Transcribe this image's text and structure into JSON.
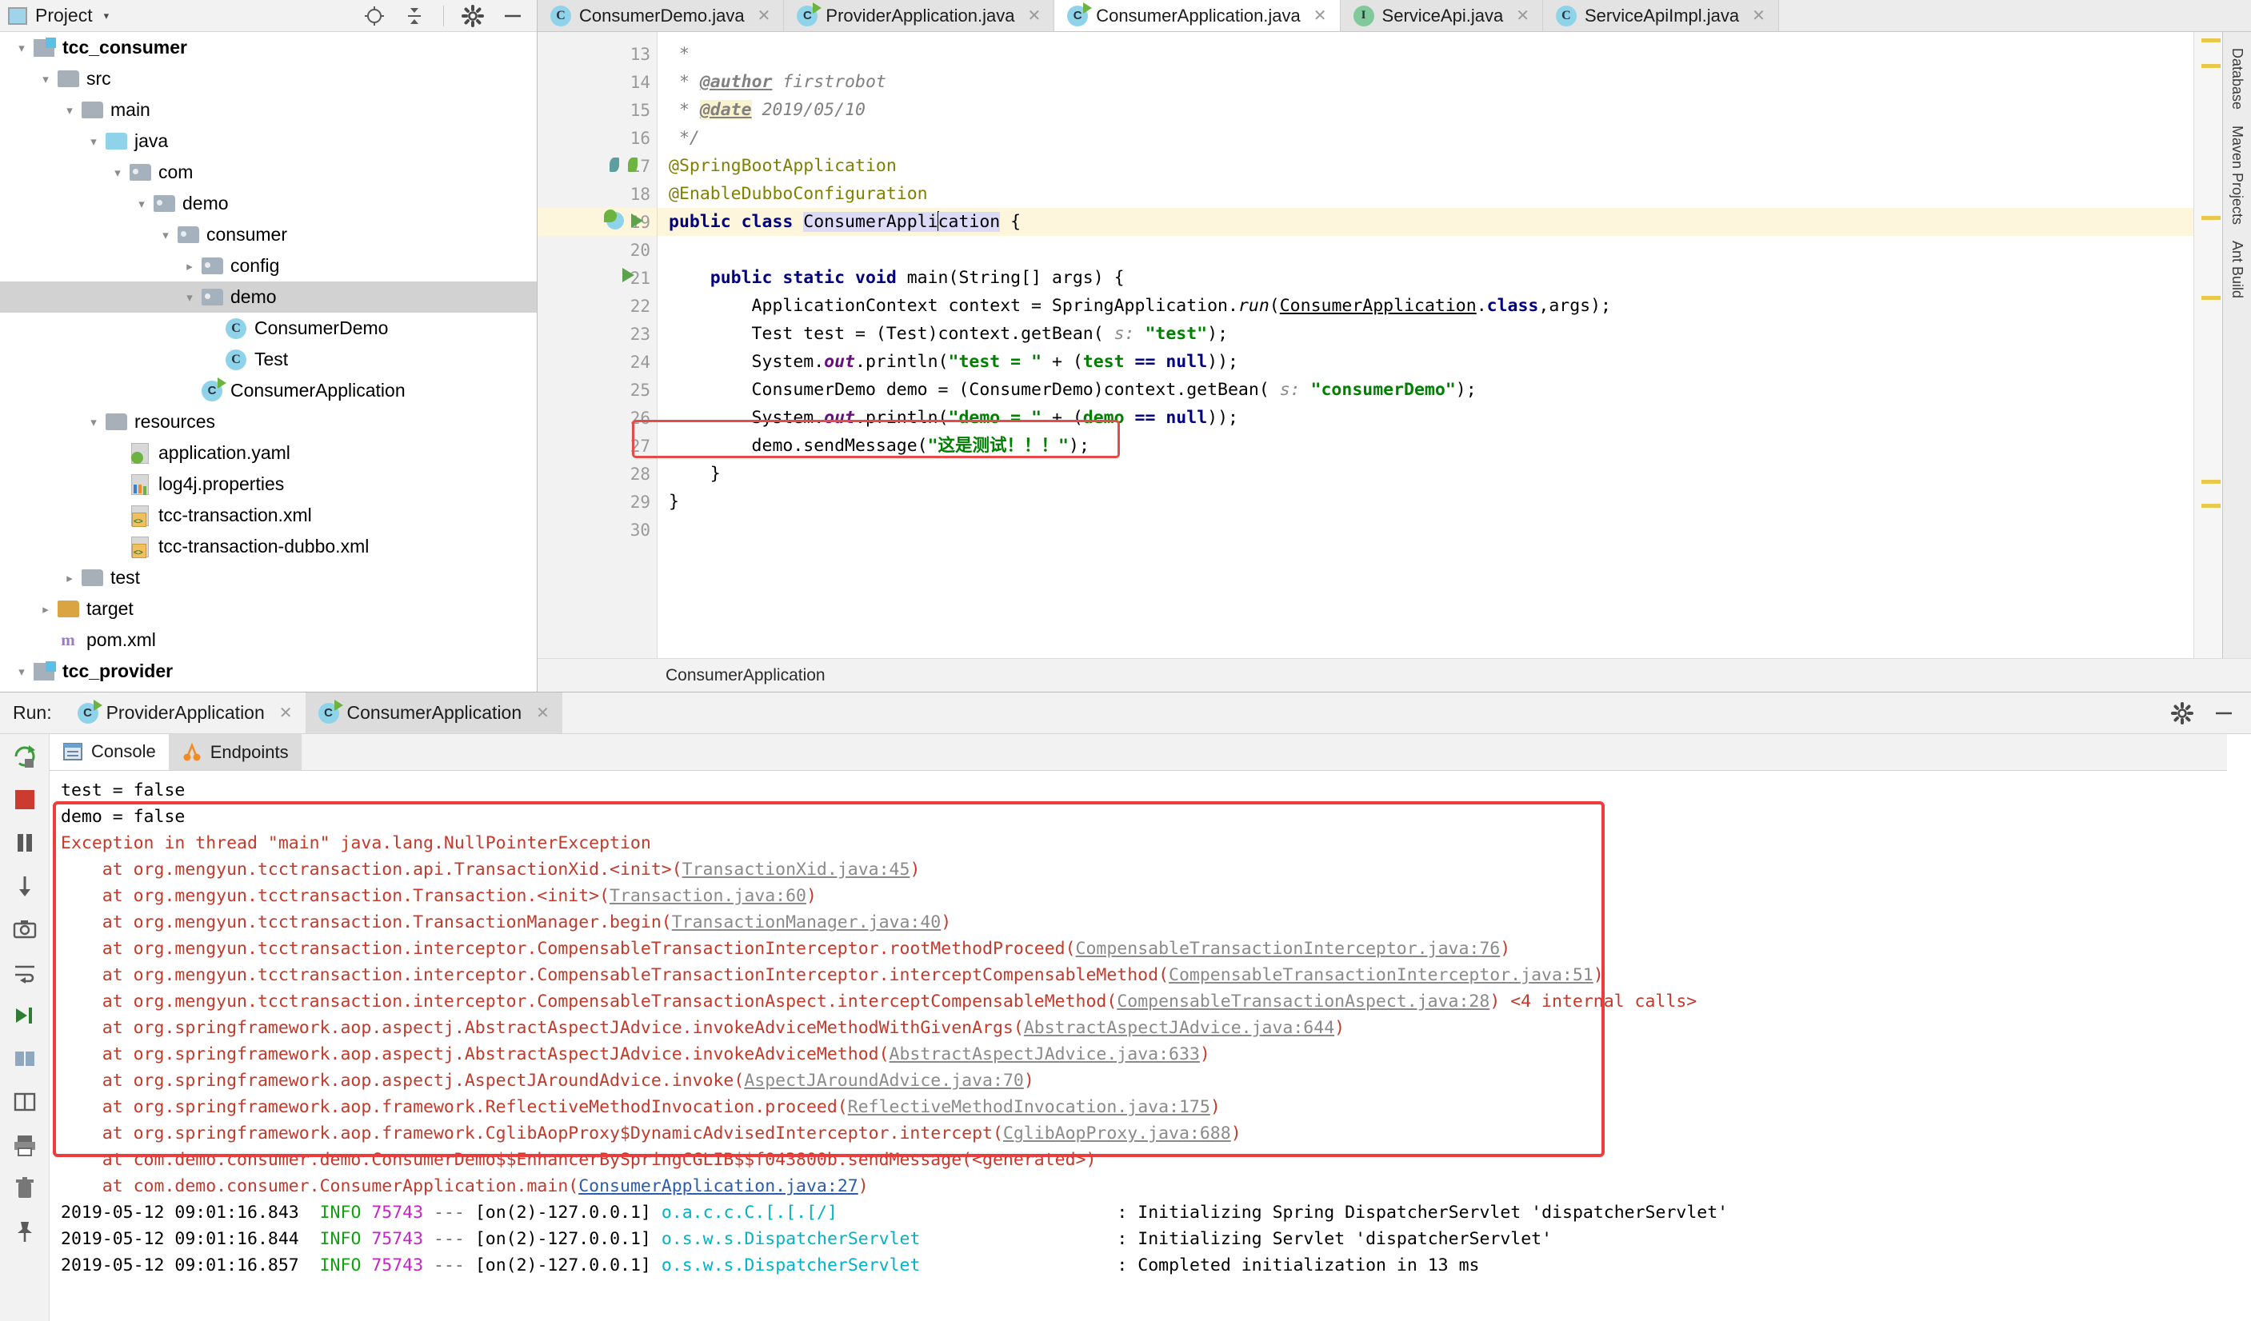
{
  "project_panel": {
    "title": "Project",
    "caret": "▾",
    "icons": [
      "locate-icon",
      "collapse-all-icon",
      "gear-icon",
      "minimize-icon"
    ],
    "tree": [
      {
        "label": "tcc_consumer",
        "indent": 0,
        "arrow": "▾",
        "icon": "module-icon",
        "bold": true,
        "selected": false
      },
      {
        "label": "src",
        "indent": 1,
        "arrow": "▾",
        "icon": "folder-icon",
        "bold": false,
        "selected": false
      },
      {
        "label": "main",
        "indent": 2,
        "arrow": "▾",
        "icon": "folder-icon",
        "bold": false,
        "selected": false
      },
      {
        "label": "java",
        "indent": 3,
        "arrow": "▾",
        "icon": "source-folder-icon",
        "bold": false,
        "selected": false
      },
      {
        "label": "com",
        "indent": 4,
        "arrow": "▾",
        "icon": "package-icon",
        "bold": false,
        "selected": false
      },
      {
        "label": "demo",
        "indent": 5,
        "arrow": "▾",
        "icon": "package-icon",
        "bold": false,
        "selected": false
      },
      {
        "label": "consumer",
        "indent": 6,
        "arrow": "▾",
        "icon": "package-icon",
        "bold": false,
        "selected": false
      },
      {
        "label": "config",
        "indent": 7,
        "arrow": "▸",
        "icon": "package-icon",
        "bold": false,
        "selected": false
      },
      {
        "label": "demo",
        "indent": 7,
        "arrow": "▾",
        "icon": "package-icon",
        "bold": false,
        "selected": true
      },
      {
        "label": "ConsumerDemo",
        "indent": 8,
        "arrow": "",
        "icon": "class-icon",
        "bold": false,
        "selected": false
      },
      {
        "label": "Test",
        "indent": 8,
        "arrow": "",
        "icon": "class-icon",
        "bold": false,
        "selected": false
      },
      {
        "label": "ConsumerApplication",
        "indent": 7,
        "arrow": "",
        "icon": "spring-class-icon",
        "bold": false,
        "selected": false
      },
      {
        "label": "resources",
        "indent": 3,
        "arrow": "▾",
        "icon": "resource-folder-icon",
        "bold": false,
        "selected": false
      },
      {
        "label": "application.yaml",
        "indent": 4,
        "arrow": "",
        "icon": "yaml-file-icon",
        "bold": false,
        "selected": false
      },
      {
        "label": "log4j.properties",
        "indent": 4,
        "arrow": "",
        "icon": "properties-file-icon",
        "bold": false,
        "selected": false
      },
      {
        "label": "tcc-transaction.xml",
        "indent": 4,
        "arrow": "",
        "icon": "xml-file-icon",
        "bold": false,
        "selected": false
      },
      {
        "label": "tcc-transaction-dubbo.xml",
        "indent": 4,
        "arrow": "",
        "icon": "xml-file-icon",
        "bold": false,
        "selected": false
      },
      {
        "label": "test",
        "indent": 2,
        "arrow": "▸",
        "icon": "folder-icon",
        "bold": false,
        "selected": false
      },
      {
        "label": "target",
        "indent": 1,
        "arrow": "▸",
        "icon": "target-folder-icon",
        "bold": false,
        "selected": false
      },
      {
        "label": "pom.xml",
        "indent": 1,
        "arrow": "",
        "icon": "maven-file-icon",
        "bold": false,
        "selected": false
      },
      {
        "label": "tcc_provider",
        "indent": 0,
        "arrow": "▾",
        "icon": "module-icon",
        "bold": true,
        "selected": false
      }
    ]
  },
  "editor": {
    "tabs": [
      {
        "label": "ConsumerDemo.java",
        "icon": "class-icon",
        "active": false,
        "closable": true
      },
      {
        "label": "ProviderApplication.java",
        "icon": "spring-class-icon",
        "active": false,
        "closable": true
      },
      {
        "label": "ConsumerApplication.java",
        "icon": "spring-class-icon",
        "active": true,
        "closable": true
      },
      {
        "label": "ServiceApi.java",
        "icon": "interface-icon",
        "active": false,
        "closable": true
      },
      {
        "label": "ServiceApiImpl.java",
        "icon": "class-icon",
        "active": false,
        "closable": true
      }
    ],
    "breadcrumb": "ConsumerApplication",
    "first_line_number": 13,
    "lines": [
      {
        "n": 13,
        "text": " *"
      },
      {
        "n": 14,
        "text": " * @author firstrobot"
      },
      {
        "n": 15,
        "text": " * @date 2019/05/10"
      },
      {
        "n": 16,
        "text": " */"
      },
      {
        "n": 17,
        "text": "@SpringBootApplication"
      },
      {
        "n": 18,
        "text": "@EnableDubboConfiguration"
      },
      {
        "n": 19,
        "text": "public class ConsumerApplication {"
      },
      {
        "n": 20,
        "text": ""
      },
      {
        "n": 21,
        "text": "    public static void main(String[] args) {"
      },
      {
        "n": 22,
        "text": "        ApplicationContext context = SpringApplication.run(ConsumerApplication.class,args);"
      },
      {
        "n": 23,
        "text": "        Test test = (Test)context.getBean( s: \"test\");"
      },
      {
        "n": 24,
        "text": "        System.out.println(\"test = \" + (test == null));"
      },
      {
        "n": 25,
        "text": "        ConsumerDemo demo = (ConsumerDemo)context.getBean( s: \"consumerDemo\");"
      },
      {
        "n": 26,
        "text": "        System.out.println(\"demo = \" + (demo == null));"
      },
      {
        "n": 27,
        "text": "        demo.sendMessage(\"这是测试！！！\");"
      },
      {
        "n": 28,
        "text": "    }"
      },
      {
        "n": 29,
        "text": "}"
      },
      {
        "n": 30,
        "text": ""
      }
    ],
    "highlighted_line": 19,
    "annotation_rect_line": 27,
    "right_strip_labels": [
      "Database",
      "Maven Projects",
      "Ant Build"
    ]
  },
  "run_panel": {
    "run_label": "Run:",
    "tabs": [
      {
        "label": "ProviderApplication",
        "icon": "spring-run-icon",
        "active": false
      },
      {
        "label": "ConsumerApplication",
        "icon": "spring-run-icon",
        "active": true
      }
    ],
    "header_icons": [
      "gear-icon",
      "minimize-icon"
    ],
    "toolbar_icons": [
      "rerun-icon",
      "stop-icon",
      "pause-icon",
      "resume-icon",
      "camera-icon",
      "soft-wrap-icon",
      "scroll-to-end-icon",
      "print-icon",
      "layout-icon",
      "print2-icon",
      "trash-icon",
      "pin-icon"
    ],
    "console_tabs": [
      {
        "label": "Console",
        "icon": "console-icon",
        "active": true
      },
      {
        "label": "Endpoints",
        "icon": "endpoints-icon",
        "active": false
      }
    ],
    "console_lines": [
      {
        "type": "plain",
        "text": "test = false"
      },
      {
        "type": "plain",
        "text": "demo = false"
      },
      {
        "type": "error",
        "text": "Exception in thread \"main\" java.lang.NullPointerException"
      },
      {
        "type": "error-link",
        "prefix": "    at org.mengyun.tcctransaction.api.TransactionXid.<init>(",
        "link": "TransactionXid.java:45",
        "suffix": ")"
      },
      {
        "type": "error-link",
        "prefix": "    at org.mengyun.tcctransaction.Transaction.<init>(",
        "link": "Transaction.java:60",
        "suffix": ")"
      },
      {
        "type": "error-link",
        "prefix": "    at org.mengyun.tcctransaction.TransactionManager.begin(",
        "link": "TransactionManager.java:40",
        "suffix": ")"
      },
      {
        "type": "error-link",
        "prefix": "    at org.mengyun.tcctransaction.interceptor.CompensableTransactionInterceptor.rootMethodProceed(",
        "link": "CompensableTransactionInterceptor.java:76",
        "suffix": ")"
      },
      {
        "type": "error-link",
        "prefix": "    at org.mengyun.tcctransaction.interceptor.CompensableTransactionInterceptor.interceptCompensableMethod(",
        "link": "CompensableTransactionInterceptor.java:51",
        "suffix": ")"
      },
      {
        "type": "error-link-note",
        "prefix": "    at org.mengyun.tcctransaction.interceptor.CompensableTransactionAspect.interceptCompensableMethod(",
        "link": "CompensableTransactionAspect.java:28",
        "suffix": ")",
        "note": "<4 internal calls>"
      },
      {
        "type": "error-link",
        "prefix": "    at org.springframework.aop.aspectj.AbstractAspectJAdvice.invokeAdviceMethodWithGivenArgs(",
        "link": "AbstractAspectJAdvice.java:644",
        "suffix": ")"
      },
      {
        "type": "error-link",
        "prefix": "    at org.springframework.aop.aspectj.AbstractAspectJAdvice.invokeAdviceMethod(",
        "link": "AbstractAspectJAdvice.java:633",
        "suffix": ")"
      },
      {
        "type": "error-link",
        "prefix": "    at org.springframework.aop.aspectj.AspectJAroundAdvice.invoke(",
        "link": "AspectJAroundAdvice.java:70",
        "suffix": ")"
      },
      {
        "type": "error-link",
        "prefix": "    at org.springframework.aop.framework.ReflectiveMethodInvocation.proceed(",
        "link": "ReflectiveMethodInvocation.java:175",
        "suffix": ")"
      },
      {
        "type": "error-link",
        "prefix": "    at org.springframework.aop.framework.CglibAopProxy$DynamicAdvisedInterceptor.intercept(",
        "link": "CglibAopProxy.java:688",
        "suffix": ")"
      },
      {
        "type": "error-plain",
        "text": "    at com.demo.consumer.demo.ConsumerDemo$$EnhancerBySpringCGLIB$$f043800b.sendMessage(<generated>)"
      },
      {
        "type": "error-link-blue",
        "prefix": "    at com.demo.consumer.ConsumerApplication.main(",
        "link": "ConsumerApplication.java:27",
        "suffix": ")"
      }
    ],
    "log_lines": [
      {
        "ts": "2019-05-12 09:01:16.843",
        "level": "INFO",
        "pid": "75743",
        "sep": "---",
        "thread": "[on(2)-127.0.0.1]",
        "logger": "o.a.c.c.C.[.[.[/]",
        "colon": ":",
        "msg": "Initializing Spring DispatcherServlet 'dispatcherServlet'"
      },
      {
        "ts": "2019-05-12 09:01:16.844",
        "level": "INFO",
        "pid": "75743",
        "sep": "---",
        "thread": "[on(2)-127.0.0.1]",
        "logger": "o.s.w.s.DispatcherServlet",
        "colon": ":",
        "msg": "Initializing Servlet 'dispatcherServlet'"
      },
      {
        "ts": "2019-05-12 09:01:16.857",
        "level": "INFO",
        "pid": "75743",
        "sep": "---",
        "thread": "[on(2)-127.0.0.1]",
        "logger": "o.s.w.s.DispatcherServlet",
        "colon": ":",
        "msg": "Completed initialization in 13 ms"
      }
    ]
  },
  "colors": {
    "accent_red": "#ee3b3b",
    "spring_green": "#6cb33f",
    "selection_grey": "#d2d2d2",
    "highlight_yellow": "#fdf6dd",
    "link_blue": "#2a5db0"
  }
}
